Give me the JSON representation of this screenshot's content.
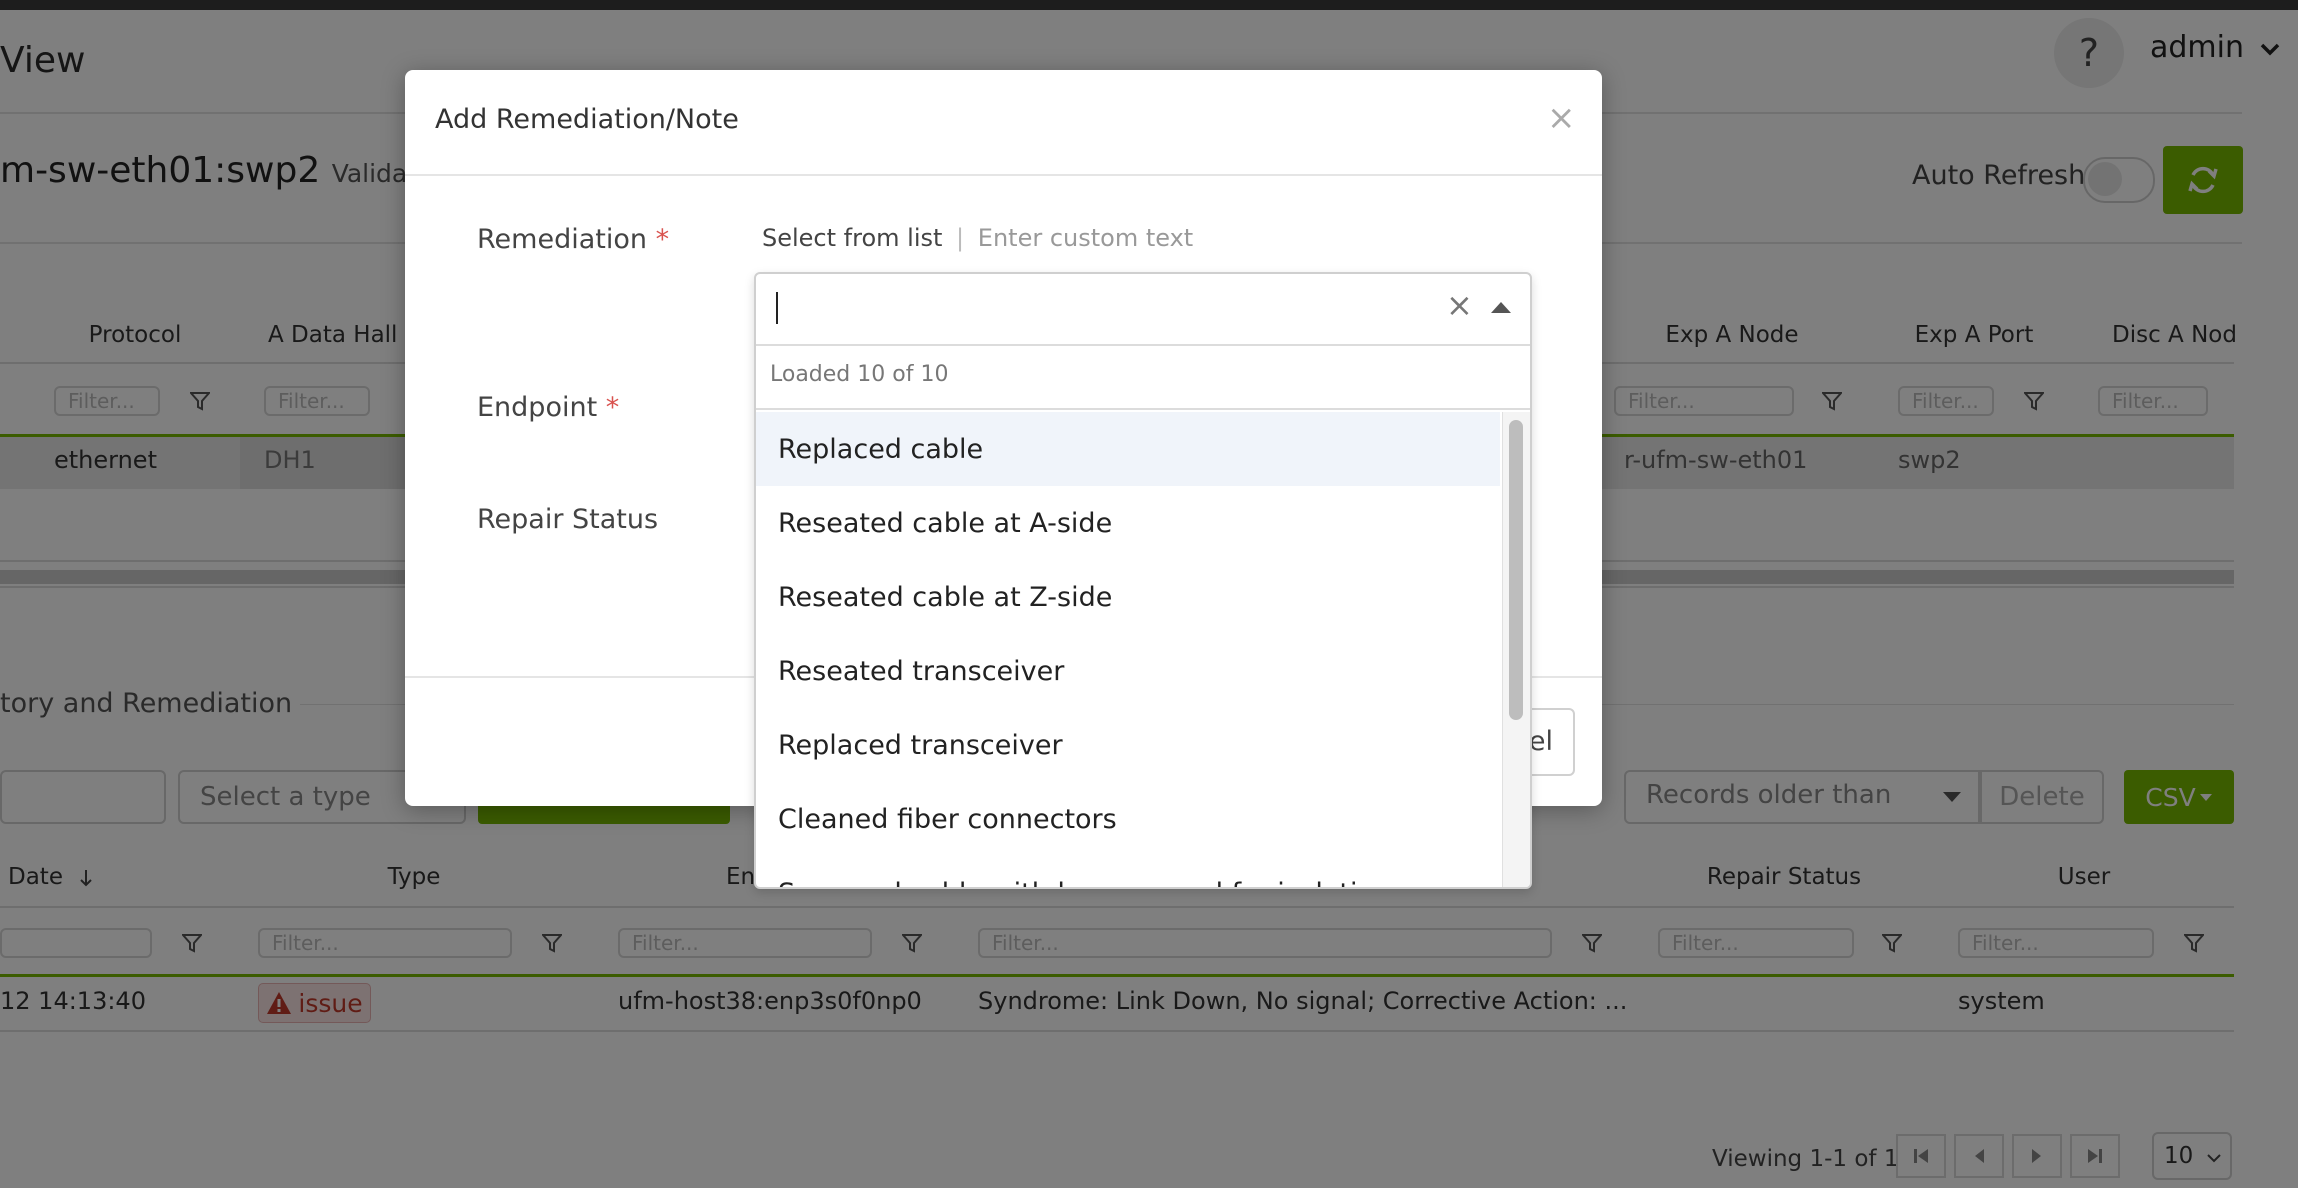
{
  "page": {
    "title": "View",
    "help_label": "?",
    "user": "admin"
  },
  "header": {
    "port_title": "m-sw-eth01:swp2",
    "port_sub": "Validatio",
    "auto_refresh_label": "Auto Refresh"
  },
  "table1": {
    "columns": [
      "Protocol",
      "A Data Hall",
      "Exp A Node",
      "Exp A Port",
      "Disc A Nod"
    ],
    "filter_placeholder": "Filter...",
    "row": {
      "protocol": "ethernet",
      "a_data_hall": "DH1",
      "exp_a_node": "r-ufm-sw-eth01",
      "exp_a_port": "swp2"
    }
  },
  "history": {
    "title": "tory and Remediation",
    "type_select_placeholder": "Select a type",
    "records_older_than": "Records older than",
    "delete_label": "Delete",
    "csv_label": "CSV",
    "columns": [
      "Date",
      "Type",
      "En",
      "Repair Status",
      "User"
    ],
    "filter_placeholder": "Filter...",
    "row": {
      "date": "12 14:13:40",
      "type": "issue",
      "endpoint": "ufm-host38:enp3s0f0np0",
      "details": "Syndrome: Link Down, No signal; Corrective Action: ...",
      "user": "system"
    },
    "viewing": "Viewing 1-1 of 1",
    "page_size": "10"
  },
  "modal": {
    "title": "Add Remediation/Note",
    "close": "×",
    "remediation_label": "Remediation",
    "endpoint_label": "Endpoint",
    "repair_status_label": "Repair Status",
    "required_mark": "*",
    "mode_select_from_list": "Select from list",
    "mode_separator": "|",
    "mode_custom_text": "Enter custom text",
    "cancel_partial": "el"
  },
  "dropdown": {
    "loaded_text": "Loaded 10 of 10",
    "clear_icon": "×",
    "options": [
      "Replaced cable",
      "Reseated cable at A-side",
      "Reseated cable at Z-side",
      "Reseated transceiver",
      "Replaced transceiver",
      "Cleaned fiber connectors",
      "Swapped cable with known-good for isolation"
    ]
  },
  "colors": {
    "accent": "#76b900",
    "required": "#d9534f",
    "issue": "#c0392b"
  }
}
